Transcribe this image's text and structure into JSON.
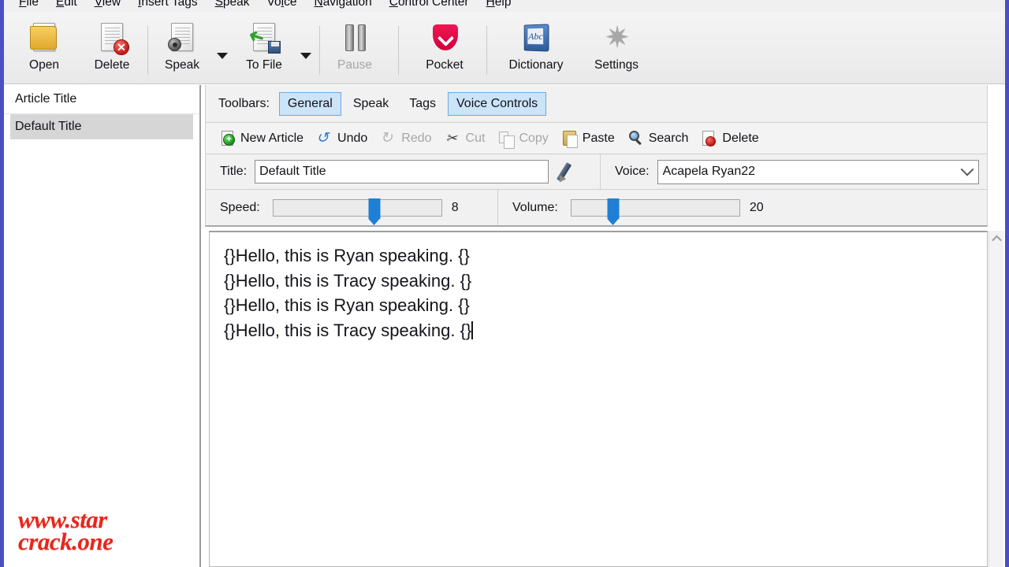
{
  "menu": {
    "items": [
      {
        "label": "File",
        "accel": "F"
      },
      {
        "label": "Edit",
        "accel": "E"
      },
      {
        "label": "View",
        "accel": "V"
      },
      {
        "label": "Insert Tags",
        "accel": "I"
      },
      {
        "label": "Speak",
        "accel": "S"
      },
      {
        "label": "Voice",
        "accel": "c"
      },
      {
        "label": "Navigation",
        "accel": "N"
      },
      {
        "label": "Control Center",
        "accel": "C"
      },
      {
        "label": "Help",
        "accel": "H"
      }
    ]
  },
  "main_toolbar": {
    "buttons": [
      {
        "label": "Open",
        "icon": "open-folder-document-icon",
        "disabled": false
      },
      {
        "label": "Delete",
        "icon": "delete-document-icon",
        "disabled": false
      },
      {
        "label": "Speak",
        "icon": "speak-document-icon",
        "disabled": false
      },
      {
        "label": "To File",
        "icon": "save-to-file-icon",
        "disabled": false
      },
      {
        "label": "Pause",
        "icon": "pause-icon",
        "disabled": true
      },
      {
        "label": "Pocket",
        "icon": "pocket-icon",
        "disabled": false
      },
      {
        "label": "Dictionary",
        "icon": "dictionary-book-icon",
        "disabled": false
      },
      {
        "label": "Settings",
        "icon": "gear-icon",
        "disabled": false
      }
    ]
  },
  "sidebar": {
    "header": "Article Title",
    "rows": [
      {
        "label": "Default Title",
        "selected": true
      }
    ]
  },
  "toolbars_row": {
    "label": "Toolbars:",
    "chips": [
      {
        "label": "General",
        "active": true
      },
      {
        "label": "Speak",
        "active": false
      },
      {
        "label": "Tags",
        "active": false
      },
      {
        "label": "Voice Controls",
        "active": true
      }
    ]
  },
  "sub_toolbar": {
    "buttons": [
      {
        "label": "New Article",
        "icon": "new-article-icon",
        "disabled": false
      },
      {
        "label": "Undo",
        "icon": "undo-icon",
        "disabled": false
      },
      {
        "label": "Redo",
        "icon": "redo-icon",
        "disabled": true
      },
      {
        "label": "Cut",
        "icon": "scissors-icon",
        "disabled": true
      },
      {
        "label": "Copy",
        "icon": "copy-icon",
        "disabled": true
      },
      {
        "label": "Paste",
        "icon": "paste-clipboard-icon",
        "disabled": false
      },
      {
        "label": "Search",
        "icon": "magnifier-icon",
        "disabled": false
      },
      {
        "label": "Delete",
        "icon": "delete-document-icon",
        "disabled": false
      }
    ]
  },
  "title_row": {
    "title_label": "Title:",
    "title_value": "Default Title",
    "title_placeholder": "",
    "pencil_icon": "pencil-icon",
    "voice_label": "Voice:",
    "voice_value": "Acapela Ryan22",
    "voice_chevron_icon": "chevron-down-icon"
  },
  "controls_row": {
    "speed_label": "Speed:",
    "speed_value": "8",
    "speed_percent": 60,
    "volume_label": "Volume:",
    "volume_value": "20",
    "volume_percent": 25
  },
  "editor": {
    "lines": [
      "{}Hello, this is Ryan speaking. {}",
      "{}Hello, this is Tracy speaking. {}",
      "{}Hello, this is Ryan speaking. {}",
      "{}Hello, this is Tracy speaking. {}"
    ]
  },
  "scrollbar": {
    "up_icon": "chevron-up-icon"
  },
  "watermark": {
    "line1": "www.star",
    "line2": "crack.one"
  },
  "colors": {
    "window_border": "#4d4dc6",
    "chip_active_bg": "#cce4f7",
    "chip_active_border": "#6fa8dc",
    "slider_thumb": "#1f7fd6",
    "selection_bg": "#d6d6d6",
    "watermark": "#e8261c",
    "toolbar_bg": "#f0f0f0"
  }
}
